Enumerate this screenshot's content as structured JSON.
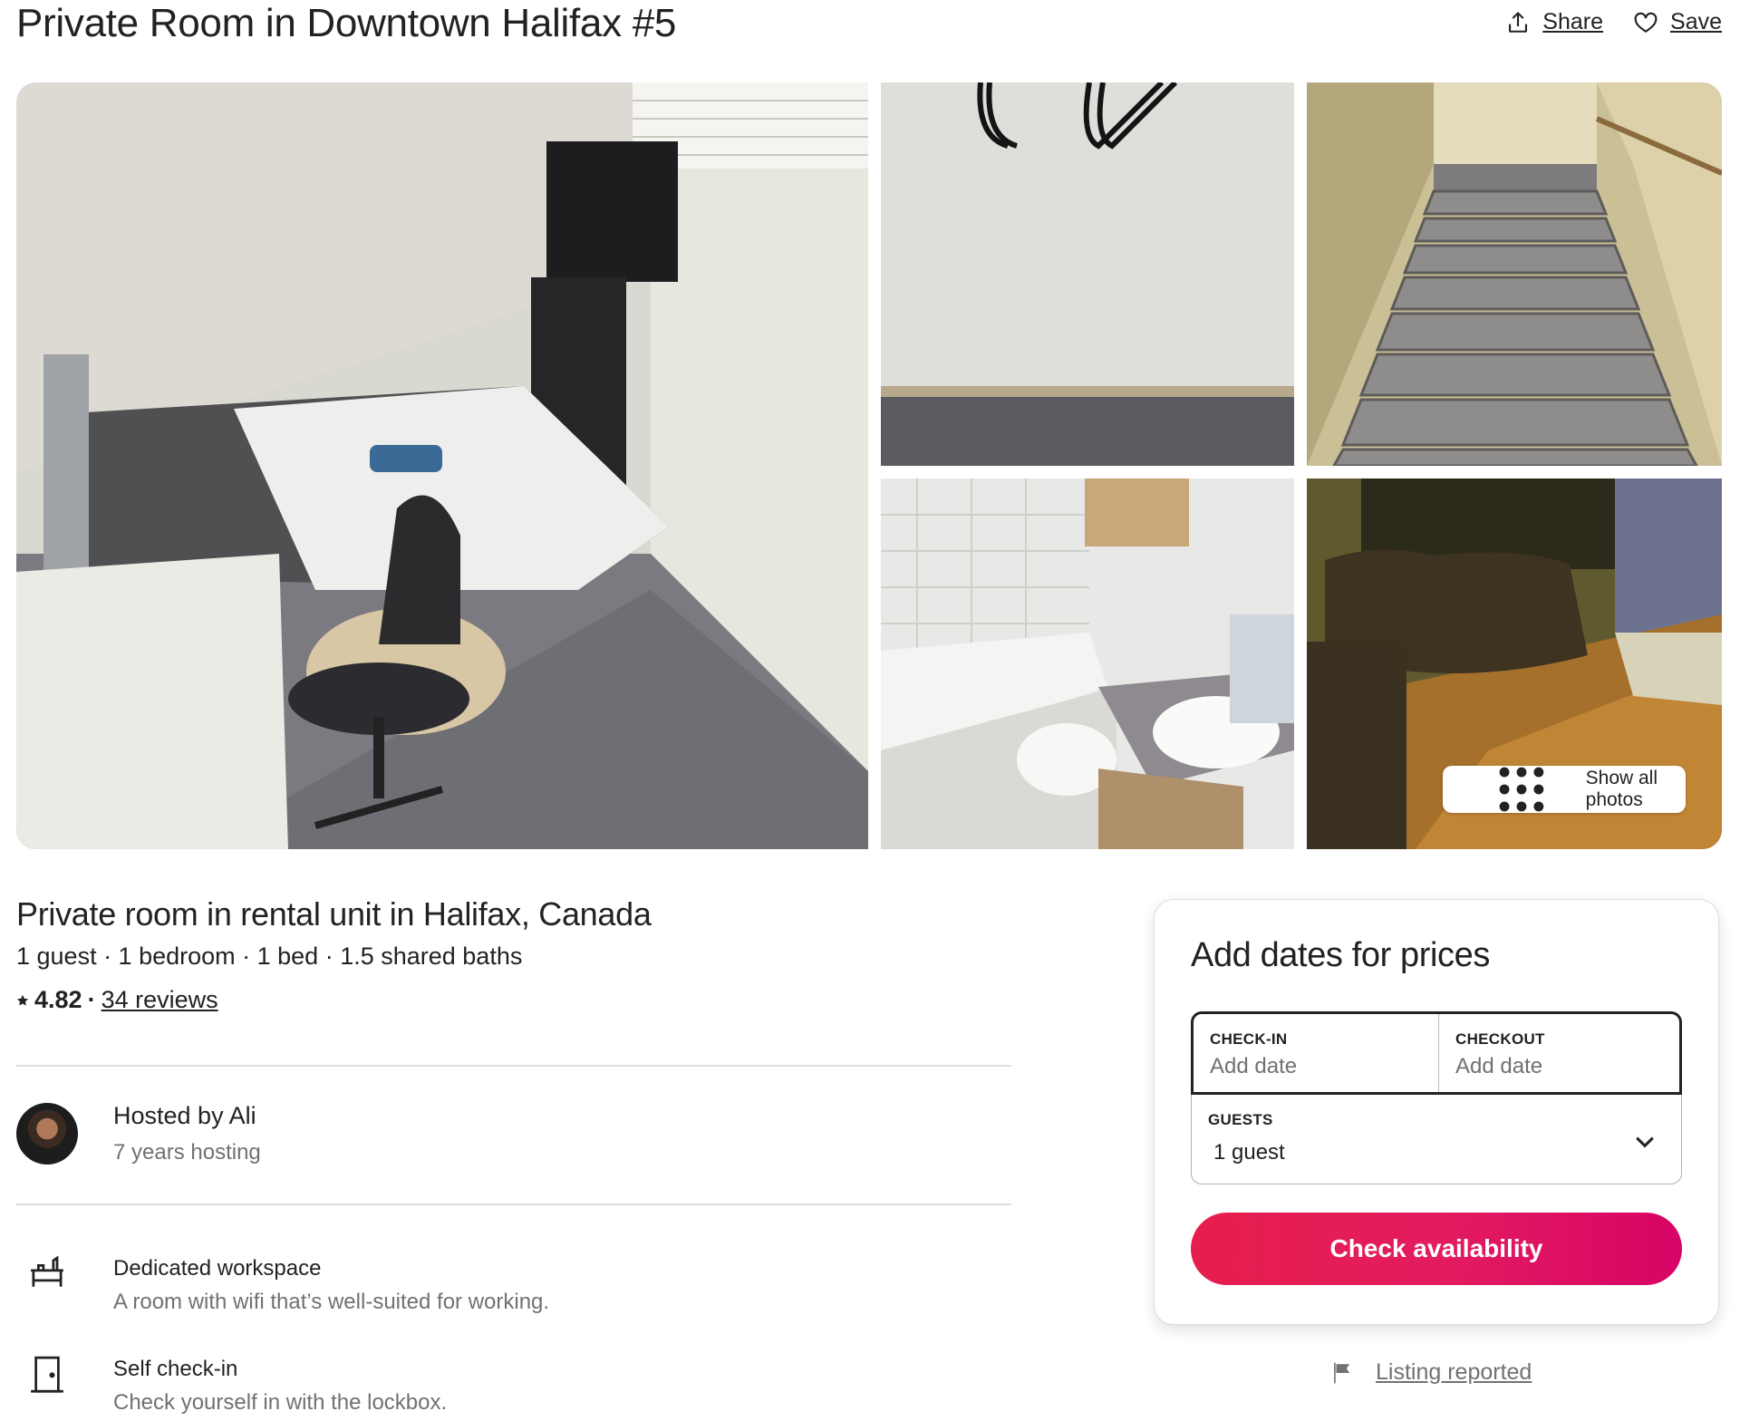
{
  "listing": {
    "title": "Private Room in Downtown Halifax #5",
    "share_label": "Share",
    "save_label": "Save"
  },
  "gallery": {
    "show_all_label": "Show all photos"
  },
  "summary": {
    "subtitle": "Private room in rental unit in Halifax, Canada",
    "details": "1 guest · 1 bedroom · 1 bed · 1.5 shared baths",
    "rating": "4.82",
    "separator": "·",
    "reviews_link": "34 reviews"
  },
  "host": {
    "name": "Hosted by Ali",
    "hosting_years": "7 years hosting"
  },
  "features": [
    {
      "title": "Dedicated workspace",
      "subtitle": "A room with wifi that’s well-suited for working.",
      "icon": "desk-icon"
    },
    {
      "title": "Self check-in",
      "subtitle": "Check yourself in with the lockbox.",
      "icon": "door-icon"
    }
  ],
  "booking": {
    "title": "Add dates for prices",
    "checkin_label": "CHECK-IN",
    "checkin_value": "Add date",
    "checkout_label": "CHECKOUT",
    "checkout_value": "Add date",
    "guests_label": "GUESTS",
    "guests_value": "1 guest",
    "button_label": "Check availability",
    "accent_color": "#E31C5F"
  },
  "report": {
    "label": "Listing reported"
  }
}
